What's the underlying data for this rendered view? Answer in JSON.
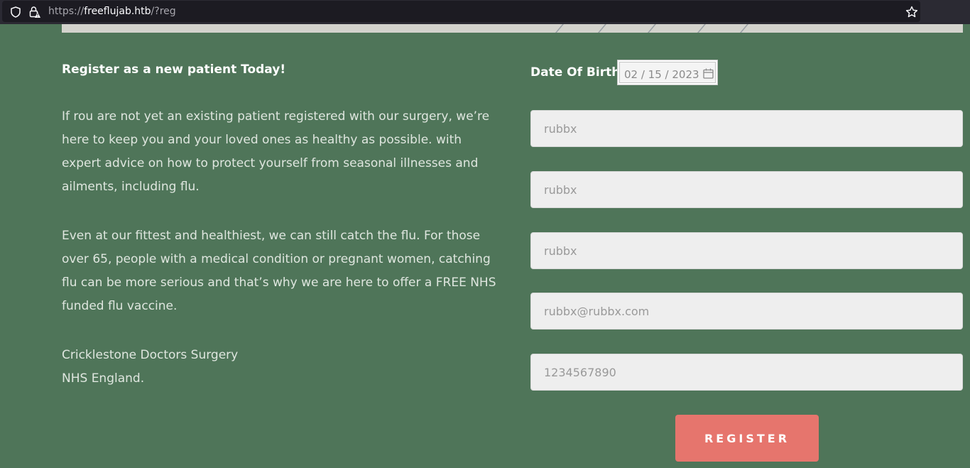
{
  "browser": {
    "url_prefix": "https://",
    "url_domain": "freeflujab.htb",
    "url_suffix": "/?reg"
  },
  "content": {
    "heading": "Register as a new patient Today!",
    "paragraph1": "If rou are not yet an existing patient registered with our surgery, we’re here to keep you and your loved ones as healthy as possible. with expert advice on how to protect yourself from seasonal illnesses and ailments, including flu.",
    "paragraph2": "Even at our fittest and healthiest, we can still catch the flu. For those over 65, people with a medical condition or pregnant women, catching flu can be more serious and that’s why we are here to offer a FREE NHS funded flu vaccine.",
    "signature_line1": "Cricklestone Doctors Surgery",
    "signature_line2": "NHS England."
  },
  "form": {
    "dob_label": "Date Of Birth:",
    "dob_value": "02 / 15 / 2023",
    "field1_value": "rubbx",
    "field2_value": "rubbx",
    "field3_value": "rubbx",
    "email_value": "rubbx@rubbx.com",
    "phone_value": "1234567890",
    "register_label": "REGISTER"
  },
  "colors": {
    "background": "#4f7559",
    "button": "#e6756d"
  }
}
